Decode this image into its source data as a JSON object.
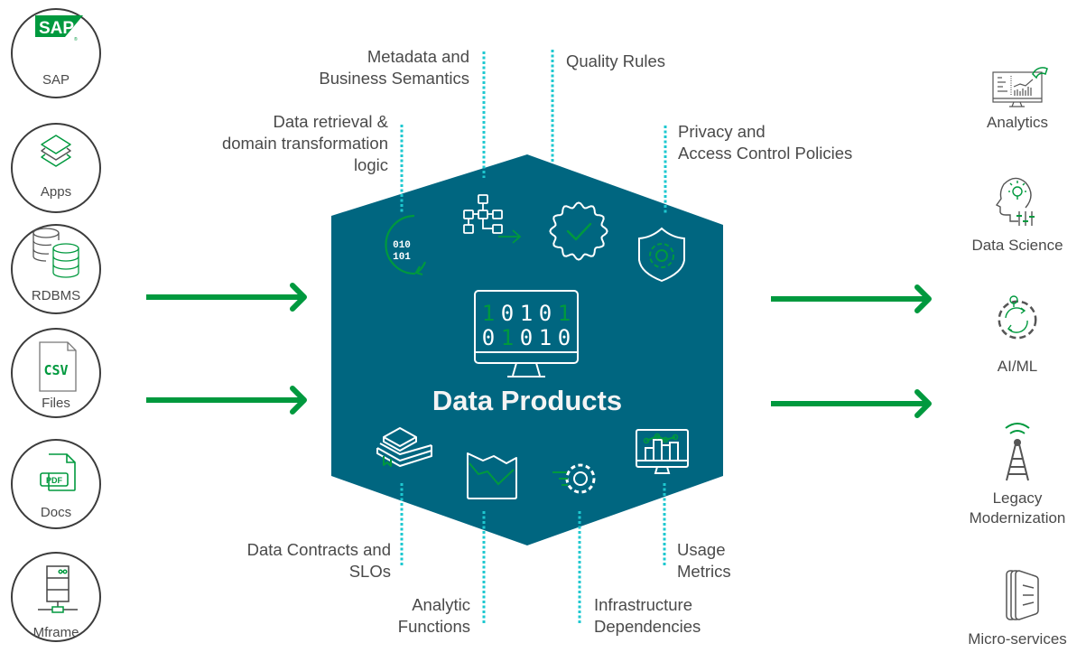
{
  "colors": {
    "hexagon_fill": "#006680",
    "arrow_green": "#00993e",
    "dotted_line": "#1ec8d0",
    "icon_gray": "#4a4a4a",
    "text_gray": "#4a4a4a"
  },
  "sources": [
    {
      "label": "SAP",
      "icon": "sap-logo-icon"
    },
    {
      "label": "Apps",
      "icon": "layers-icon"
    },
    {
      "label": "RDBMS",
      "icon": "database-icon"
    },
    {
      "label": "Files",
      "icon": "csv-file-icon",
      "icon_text": "CSV"
    },
    {
      "label": "Docs",
      "icon": "pdf-file-icon",
      "icon_text": "PDF"
    },
    {
      "label": "Mframe",
      "icon": "mainframe-server-icon"
    }
  ],
  "hub": {
    "title": "Data Products",
    "monitor_binary": [
      "10101",
      "01010"
    ],
    "retrieval_binary": [
      "010",
      "101"
    ]
  },
  "top_labels": [
    {
      "id": "retrieval",
      "lines": [
        "Data retrieval &",
        "domain transformation",
        "logic"
      ],
      "icon": "binary-cycle-icon"
    },
    {
      "id": "metadata",
      "lines": [
        "Metadata and",
        "Business Semantics"
      ],
      "icon": "hierarchy-flow-icon"
    },
    {
      "id": "quality",
      "lines": [
        "Quality Rules"
      ],
      "icon": "quality-badge-check-icon"
    },
    {
      "id": "privacy",
      "lines": [
        "Privacy and",
        "Access Control Policies"
      ],
      "icon": "shield-gear-icon"
    }
  ],
  "bottom_labels": [
    {
      "id": "contracts",
      "lines": [
        "Data Contracts and",
        "SLOs"
      ],
      "icon": "stacked-books-icon"
    },
    {
      "id": "analytic",
      "lines": [
        "Analytic",
        "Functions"
      ],
      "icon": "line-chart-icon"
    },
    {
      "id": "infra",
      "lines": [
        "Infrastructure",
        "Dependencies"
      ],
      "icon": "fast-gear-icon"
    },
    {
      "id": "usage",
      "lines": [
        "Usage",
        "Metrics"
      ],
      "icon": "monitor-bar-chart-icon"
    }
  ],
  "destinations": [
    {
      "label_lines": [
        "Analytics"
      ],
      "icon": "analytics-dashboard-icon"
    },
    {
      "label_lines": [
        "Data Science"
      ],
      "icon": "head-lightbulb-icon"
    },
    {
      "label_lines": [
        "AI/ML"
      ],
      "icon": "gear-lightbulb-cycle-icon"
    },
    {
      "label_lines": [
        "Legacy",
        "Modernization"
      ],
      "icon": "radio-tower-icon"
    },
    {
      "label_lines": [
        "Micro-services"
      ],
      "icon": "microservices-icon"
    }
  ]
}
